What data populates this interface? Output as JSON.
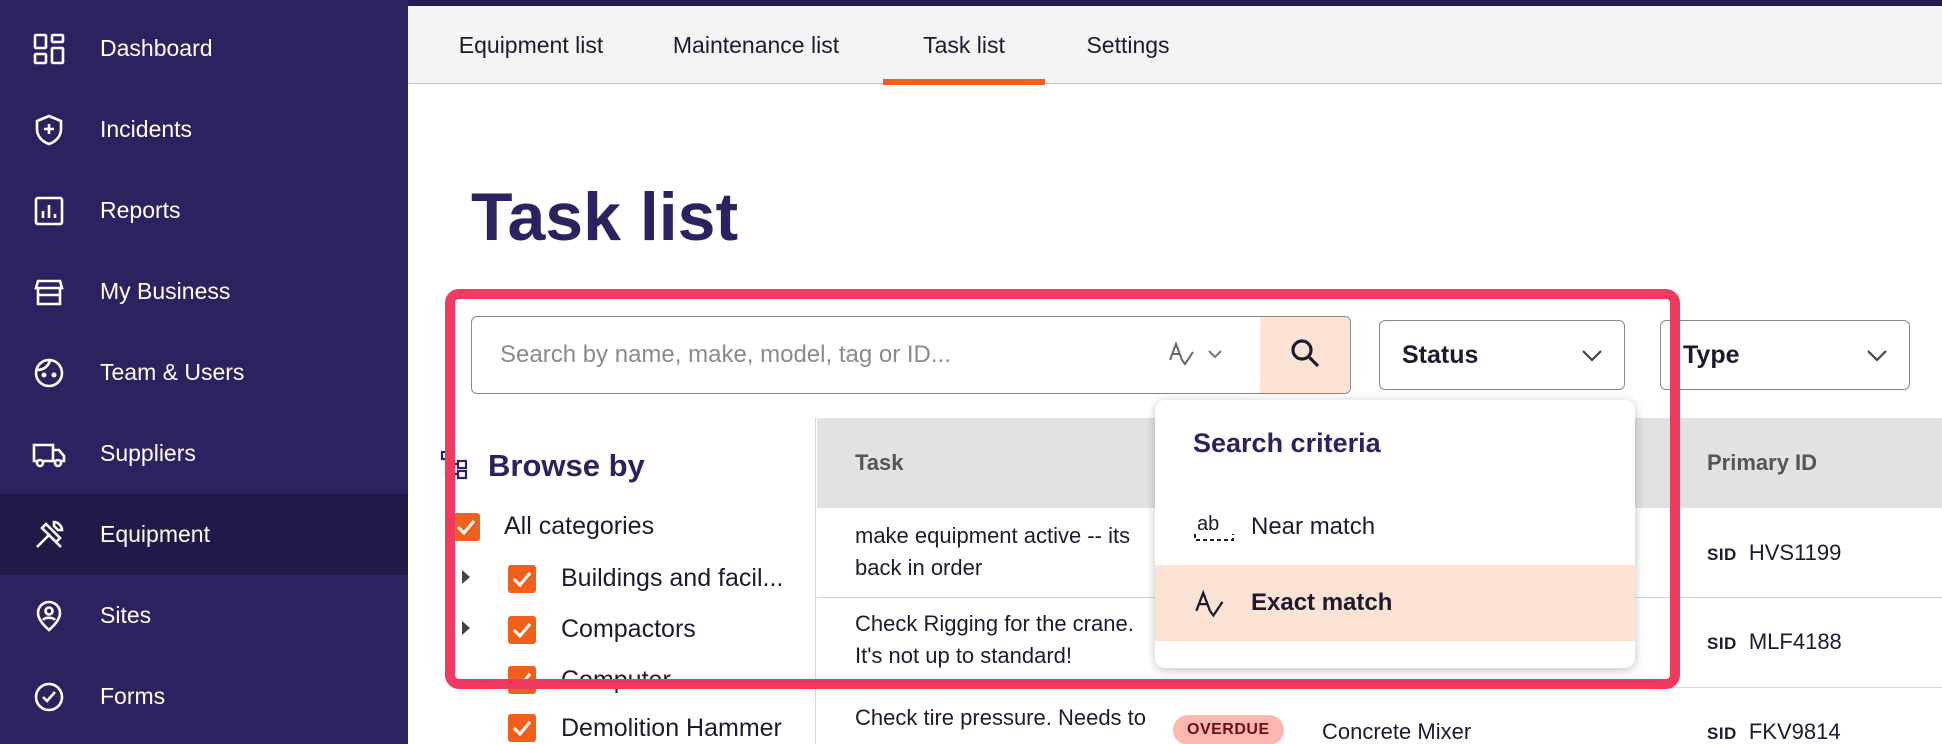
{
  "sidebar": {
    "items": [
      {
        "label": "Dashboard",
        "icon": "dashboard-icon"
      },
      {
        "label": "Incidents",
        "icon": "shield-plus-icon"
      },
      {
        "label": "Reports",
        "icon": "bar-chart-icon"
      },
      {
        "label": "My Business",
        "icon": "storefront-icon"
      },
      {
        "label": "Team & Users",
        "icon": "face-icon"
      },
      {
        "label": "Suppliers",
        "icon": "truck-icon"
      },
      {
        "label": "Equipment",
        "icon": "tools-icon",
        "active": true
      },
      {
        "label": "Sites",
        "icon": "location-pin-icon"
      },
      {
        "label": "Forms",
        "icon": "check-circle-icon"
      }
    ]
  },
  "tabs": [
    {
      "label": "Equipment list"
    },
    {
      "label": "Maintenance list"
    },
    {
      "label": "Task list",
      "active": true
    },
    {
      "label": "Settings"
    }
  ],
  "page": {
    "title": "Task list"
  },
  "search": {
    "placeholder": "Search by name, make, model, tag or ID...",
    "value": ""
  },
  "filters": {
    "status_label": "Status",
    "type_label": "Type"
  },
  "browse": {
    "title": "Browse by",
    "items": [
      {
        "label": "All categories",
        "checked": true
      },
      {
        "label": "Buildings and facil...",
        "checked": true
      },
      {
        "label": "Compactors",
        "checked": true
      },
      {
        "label": "Computer",
        "checked": true
      },
      {
        "label": "Demolition Hammer",
        "checked": true
      }
    ]
  },
  "table": {
    "headers": {
      "task": "Task",
      "primary_id": "Primary ID"
    },
    "rows": [
      {
        "task_line1": "make equipment active -- its",
        "task_line2": "back in order",
        "equipment": "",
        "sid_prefix": "SID",
        "primary_id": "HVS1199"
      },
      {
        "task_line1": "Check Rigging for the crane.",
        "task_line2": "It's not up to standard!",
        "equipment": "",
        "sid_prefix": "SID",
        "primary_id": "MLF4188"
      },
      {
        "task_line1": "Check tire pressure. Needs to",
        "task_line2": "",
        "badge": "OVERDUE",
        "equipment": "Concrete Mixer",
        "sid_prefix": "SID",
        "primary_id": "FKV9814"
      }
    ]
  },
  "search_criteria": {
    "title": "Search criteria",
    "options": [
      {
        "label": "Near match",
        "icon": "near-match-icon",
        "selected": false
      },
      {
        "label": "Exact match",
        "icon": "exact-match-icon",
        "selected": true
      }
    ]
  },
  "colors": {
    "sidebar_bg": "#2b2360",
    "accent": "#f05f1b",
    "title": "#2b2360",
    "highlight": "#f03a5f",
    "selected_bg": "#fde3d4"
  }
}
